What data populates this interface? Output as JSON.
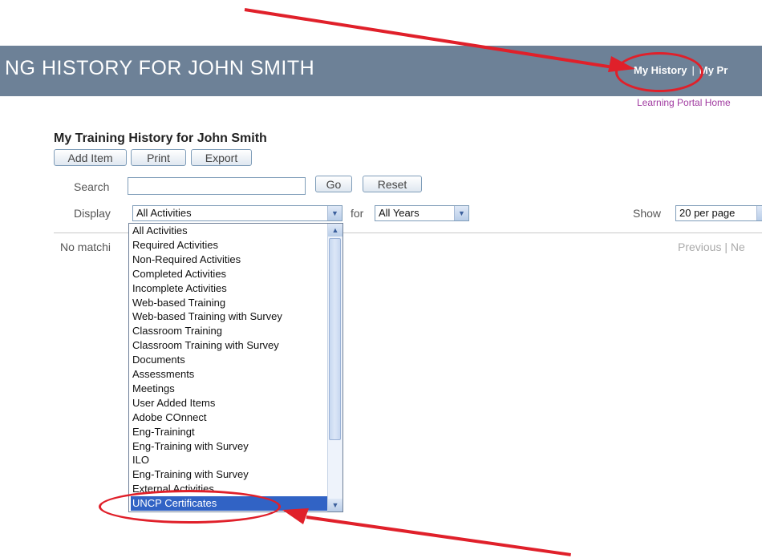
{
  "header": {
    "title": "NG HISTORY FOR JOHN SMITH",
    "links": {
      "my_history": "My History",
      "separator": "|",
      "my_profile": "My Pr"
    },
    "portal_link": "Learning Portal Home"
  },
  "page": {
    "title": "My Training History for John Smith",
    "buttons": {
      "add_item": "Add Item",
      "print": "Print",
      "export": "Export"
    }
  },
  "search": {
    "label": "Search",
    "value": "",
    "go": "Go",
    "reset": "Reset"
  },
  "filters": {
    "display_label": "Display",
    "display_value": "All Activities",
    "for_label": "for",
    "years_value": "All Years",
    "show_label": "Show",
    "per_page_value": "20 per page"
  },
  "results": {
    "no_match": "No matchi",
    "pager": "Previous | Ne"
  },
  "dropdown": {
    "options": [
      "All Activities",
      "Required Activities",
      "Non-Required Activities",
      "Completed Activities",
      "Incomplete Activities",
      "Web-based Training",
      "Web-based Training with Survey",
      "Classroom Training",
      "Classroom Training with Survey",
      "Documents",
      "Assessments",
      "Meetings",
      "User Added Items",
      "Adobe COnnect",
      "Eng-Trainingt",
      "Eng-Training with Survey",
      "ILO",
      "Eng-Training with Survey",
      "External Activities",
      "UNCP Certificates"
    ],
    "selected_index": 19
  },
  "annotation_color": "#e0202a",
  "highlight_color": "#3163c5"
}
